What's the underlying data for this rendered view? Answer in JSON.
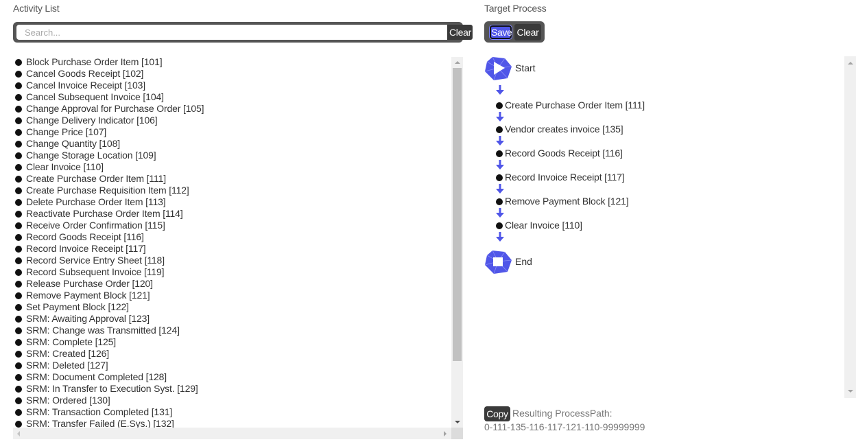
{
  "activity_panel": {
    "title": "Activity List",
    "search": {
      "placeholder": "Search...",
      "value": "",
      "clear_label": "Clear"
    },
    "items": [
      "Block Purchase Order Item [101]",
      "Cancel Goods Receipt [102]",
      "Cancel Invoice Receipt [103]",
      "Cancel Subsequent Invoice [104]",
      "Change Approval for Purchase Order [105]",
      "Change Delivery Indicator [106]",
      "Change Price [107]",
      "Change Quantity [108]",
      "Change Storage Location [109]",
      "Clear Invoice [110]",
      "Create Purchase Order Item [111]",
      "Create Purchase Requisition Item [112]",
      "Delete Purchase Order Item [113]",
      "Reactivate Purchase Order Item [114]",
      "Receive Order Confirmation [115]",
      "Record Goods Receipt [116]",
      "Record Invoice Receipt [117]",
      "Record Service Entry Sheet [118]",
      "Record Subsequent Invoice [119]",
      "Release Purchase Order [120]",
      "Remove Payment Block [121]",
      "Set Payment Block [122]",
      "SRM: Awaiting Approval [123]",
      "SRM: Change was Transmitted [124]",
      "SRM: Complete [125]",
      "SRM: Created [126]",
      "SRM: Deleted [127]",
      "SRM: Document Completed [128]",
      "SRM: In Transfer to Execution Syst. [129]",
      "SRM: Ordered [130]",
      "SRM: Transaction Completed [131]",
      "SRM: Transfer Failed (E.Sys.) [132]"
    ]
  },
  "target_panel": {
    "title": "Target Process",
    "save_label": "Save",
    "clear_label": "Clear",
    "start_label": "Start",
    "end_label": "End",
    "steps": [
      "Create Purchase Order Item [111]",
      "Vendor creates invoice [135]",
      "Record Goods Receipt [116]",
      "Record Invoice Receipt [117]",
      "Remove Payment Block [121]",
      "Clear Invoice [110]"
    ],
    "copy_label": "Copy",
    "result_label": "Resulting ProcessPath:",
    "result_path": "0-111-135-116-117-121-110-99999999"
  },
  "colors": {
    "accent": "#5056e8",
    "button_dark": "#3a3a3a",
    "toolbar_bg": "#555555"
  },
  "icons": {
    "start": "play-hexagon-icon",
    "end": "stop-hexagon-icon",
    "step_bullet": "bullet-icon",
    "flow": "arrow-down-icon"
  }
}
